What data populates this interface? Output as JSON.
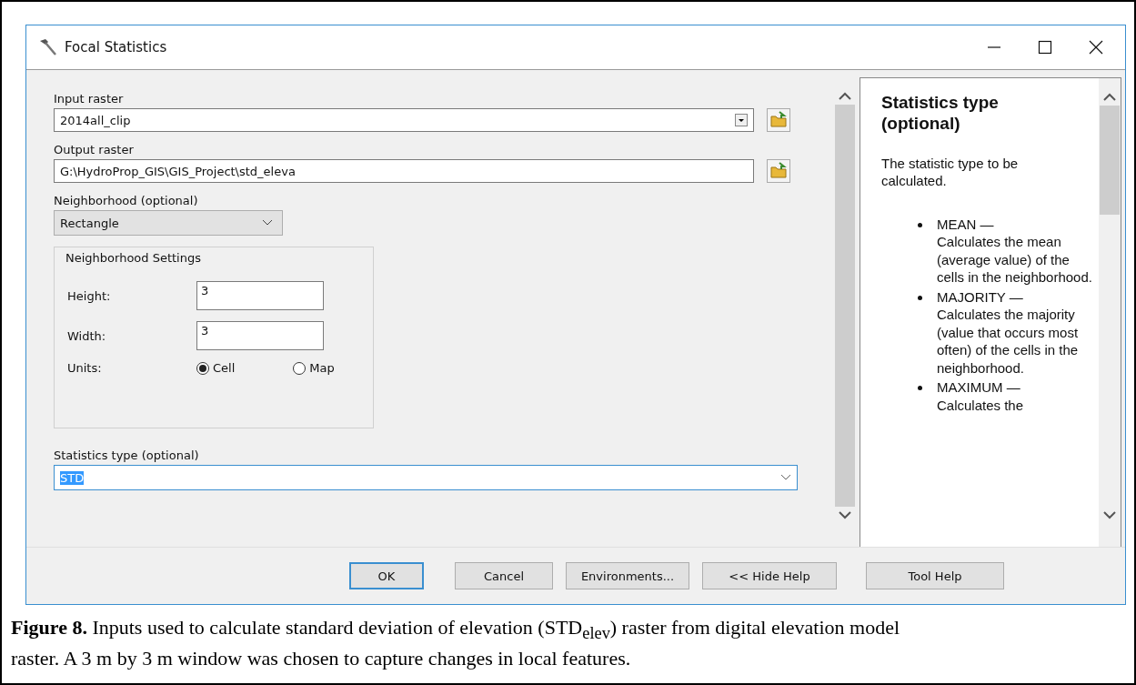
{
  "window": {
    "title": "Focal Statistics"
  },
  "form": {
    "input_raster": {
      "label": "Input raster",
      "value": "2014all_clip"
    },
    "output_raster": {
      "label": "Output raster",
      "value": "G:\\HydroProp_GIS\\GIS_Project\\std_eleva"
    },
    "neighborhood": {
      "label": "Neighborhood (optional)",
      "value": "Rectangle"
    },
    "settings": {
      "title": "Neighborhood Settings",
      "height": {
        "label": "Height:",
        "value": "3"
      },
      "width": {
        "label": "Width:",
        "value": "3"
      },
      "units": {
        "label": "Units:",
        "options": [
          {
            "label": "Cell",
            "selected": true
          },
          {
            "label": "Map",
            "selected": false
          }
        ]
      }
    },
    "statistics_type": {
      "label": "Statistics type (optional)",
      "value": "STD",
      "text_selected": true
    }
  },
  "help": {
    "title": "Statistics type (optional)",
    "intro": "The statistic type to be calculated.",
    "items": [
      {
        "name": "MEAN —",
        "text": "Calculates the mean (average value) of the cells in the neighborhood."
      },
      {
        "name": "MAJORITY —",
        "text": "Calculates the majority (value that occurs most often) of the cells in the neighborhood."
      },
      {
        "name": "MAXIMUM —",
        "text": "Calculates the"
      }
    ]
  },
  "buttons": [
    {
      "label": "OK",
      "default": true
    },
    {
      "label": "Cancel",
      "default": false
    },
    {
      "label": "Environments...",
      "default": false
    },
    {
      "label": "<< Hide Help",
      "default": false
    },
    {
      "label": "Tool Help",
      "default": false
    }
  ],
  "caption": {
    "label": "Figure 8.",
    "text": "Inputs used to calculate standard deviation of elevation (STD$_{elev}$) raster from digital elevation model raster. A 3 m by 3 m window was chosen to capture changes in local features."
  }
}
